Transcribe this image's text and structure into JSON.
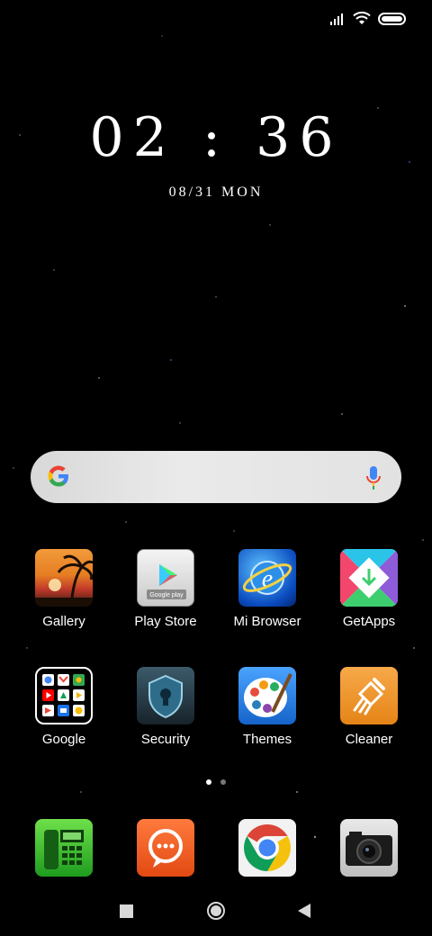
{
  "status_bar": {
    "icons": [
      "signal-icon",
      "wifi-icon",
      "battery-icon"
    ]
  },
  "clock": {
    "time": "02 : 36",
    "date": "08/31 MON"
  },
  "search_bar": {
    "icons": [
      "google-logo",
      "mic-icon"
    ]
  },
  "apps_row1": [
    {
      "label": "Gallery"
    },
    {
      "label": "Play Store"
    },
    {
      "label": "Mi Browser"
    },
    {
      "label": "GetApps"
    }
  ],
  "apps_row2": [
    {
      "label": "Google"
    },
    {
      "label": "Security"
    },
    {
      "label": "Themes"
    },
    {
      "label": "Cleaner"
    }
  ],
  "dock": {
    "icons": [
      "phone-icon",
      "messages-icon",
      "chrome-icon",
      "camera-icon"
    ]
  },
  "page_indicator": {
    "pages": 2,
    "current": 1
  },
  "nav_bar": {
    "icons": [
      "recents-icon",
      "home-icon",
      "back-icon"
    ]
  },
  "colors": {
    "background": "#000000",
    "search_bg": "#e0e0e0",
    "text": "#ffffff"
  }
}
